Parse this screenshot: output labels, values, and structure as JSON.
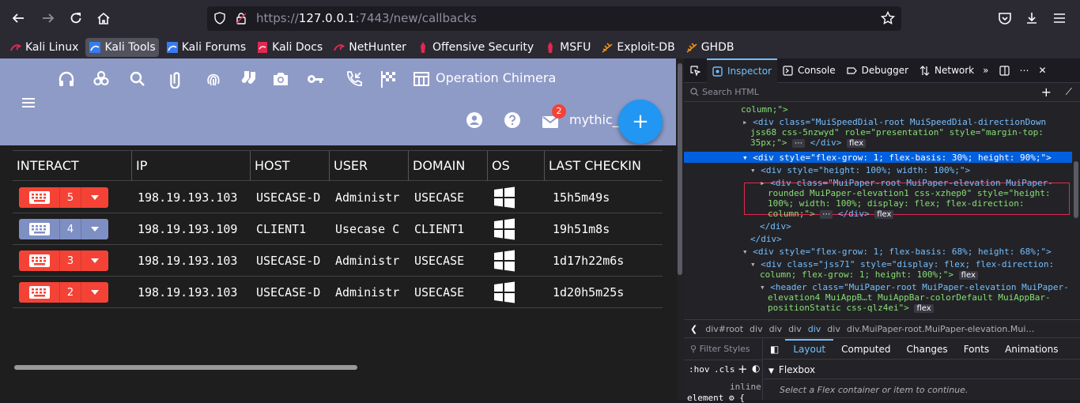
{
  "browser": {
    "url": {
      "prefix": "https://",
      "host": "127.0.0.1",
      "rest": ":7443/new/callbacks"
    },
    "bookmarks": [
      {
        "label": "Kali Linux",
        "icon": "kali-icon"
      },
      {
        "label": "Kali Tools",
        "icon": "kali-tools-icon"
      },
      {
        "label": "Kali Forums",
        "icon": "kali-forums-icon"
      },
      {
        "label": "Kali Docs",
        "icon": "kali-docs-icon"
      },
      {
        "label": "NetHunter",
        "icon": "nethunter-icon"
      },
      {
        "label": "Offensive Security",
        "icon": "offsec-icon"
      },
      {
        "label": "MSFU",
        "icon": "msfu-icon"
      },
      {
        "label": "Exploit-DB",
        "icon": "exploitdb-icon"
      },
      {
        "label": "GHDB",
        "icon": "ghdb-icon"
      }
    ]
  },
  "app": {
    "operation_name": "Operation Chimera",
    "user_name": "mythic_a",
    "notification_count": "2",
    "fab_label": "+",
    "colors": {
      "appbar": "#8f9bc7",
      "fab": "#2196f3",
      "red": "#f44336",
      "blue": "#7e8fc4"
    },
    "table": {
      "columns": [
        "INTERACT",
        "IP",
        "HOST",
        "USER",
        "DOMAIN",
        "OS",
        "LAST CHECKIN"
      ],
      "rows": [
        {
          "count": "5",
          "color": "red",
          "ip": "198.19.193.103",
          "host": "USECASE-D",
          "user": "Administr",
          "domain": "USECASE",
          "os": "windows",
          "checkin": "15h5m49s"
        },
        {
          "count": "4",
          "color": "blue",
          "ip": "198.19.193.109",
          "host": "CLIENT1",
          "user": "Usecase C",
          "domain": "CLIENT1",
          "os": "windows",
          "checkin": "19h51m8s"
        },
        {
          "count": "3",
          "color": "red",
          "ip": "198.19.193.103",
          "host": "USECASE-D",
          "user": "Administr",
          "domain": "USECASE",
          "os": "windows",
          "checkin": "1d17h22m6s"
        },
        {
          "count": "2",
          "color": "red",
          "ip": "198.19.193.103",
          "host": "USECASE-D",
          "user": "Administr",
          "domain": "USECASE",
          "os": "windows",
          "checkin": "1d20h5m25s"
        }
      ]
    }
  },
  "devtools": {
    "tabs": [
      "Inspector",
      "Console",
      "Debugger",
      "Network"
    ],
    "search_placeholder": "Search HTML",
    "markup": [
      "column;\">",
      "<div class=\"MuiSpeedDial-root MuiSpeedDial-directionDown",
      "jss68 css-5nzwyd\" role=\"presentation\" style=\"margin-top:",
      "35px;\">",
      "<div style=\"flex-grow: 1; flex-basis: 30%; height: 90%;\">",
      "<div style=\"height: 100%; width: 100%;\">",
      "<div class=\"MuiPaper-root MuiPaper-elevation MuiPaper-",
      "rounded MuiPaper-elevation1 css-xzhep0\" style=\"height:",
      "100%; width: 100%; display: flex; flex-direction:",
      "column;\">",
      "</div>",
      "</div>",
      "<div style=\"flex-grow: 1; flex-basis: 68%; height: 68%;\">",
      "<div class=\"jss71\" style=\"display: flex; flex-direction:",
      "column; flex-grow: 1; height: 100%;\">",
      "<header class=\"MuiPaper-root MuiPaper-elevation MuiPaper-",
      "elevation4 MuiAppB…t MuiAppBar-colorDefault MuiAppBar-",
      "positionStatic css-qlz4ei\">"
    ],
    "flex_badge": "flex",
    "breadcrumbs": [
      "div#root",
      "div",
      "div",
      "div",
      "div",
      "div",
      "div.MuiPaper-root.MuiPaper-elevation.Mui…"
    ],
    "filter_placeholder": "Filter Styles",
    "hov": ":hov",
    "cls": ".cls",
    "subtabs": [
      "Layout",
      "Computed",
      "Changes",
      "Fonts",
      "Animations"
    ],
    "flexbox_title": "Flexbox",
    "flexbox_hint": "Select a Flex container or item to continue.",
    "element_label": "element",
    "inline_label": "inline"
  }
}
